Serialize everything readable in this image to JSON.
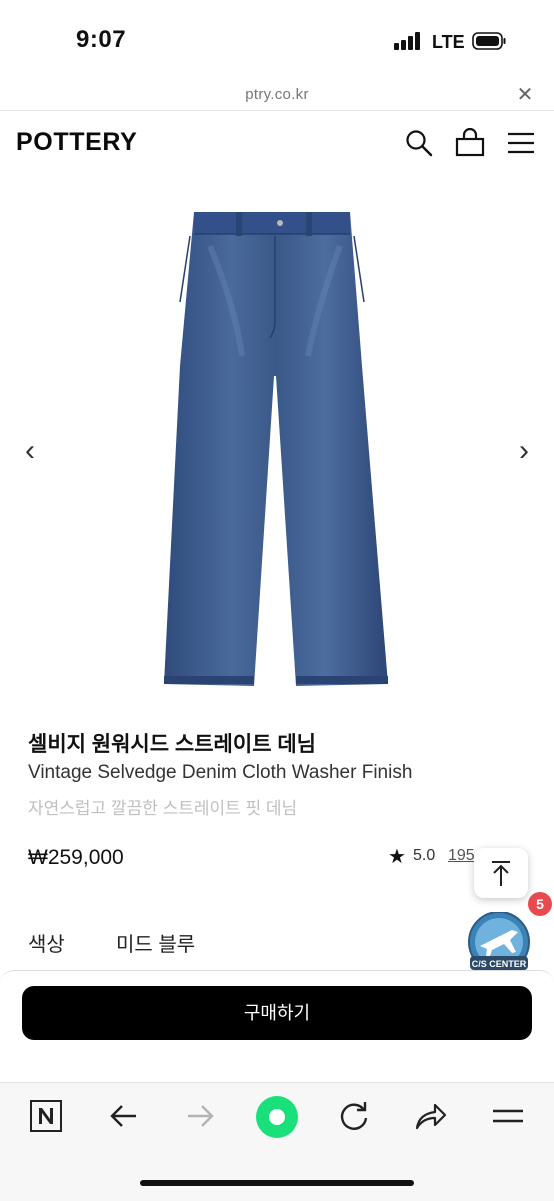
{
  "status_bar": {
    "time": "9:07",
    "network": "LTE"
  },
  "url_bar": {
    "url": "ptry.co.kr",
    "close_icon": "close-icon"
  },
  "header": {
    "logo": "POTTERY",
    "icons": [
      "search-icon",
      "shopping-bag-icon",
      "menu-icon"
    ]
  },
  "gallery": {
    "prev_arrow": "‹",
    "next_arrow": "›"
  },
  "product": {
    "name_ko": "셀비지 원워시드 스트레이트 데님",
    "name_en": "Vintage Selvedge Denim Cloth Washer Finish",
    "description": "자연스럽고 깔끔한 스트레이트 핏 데님",
    "price": "₩259,000",
    "rating": "5.0",
    "review_count": "195"
  },
  "options": {
    "color_label": "색상",
    "color_value": "미드 블루"
  },
  "floating": {
    "cs_badge": "5",
    "cs_label": "C/S CENTER"
  },
  "purchase": {
    "button_label": "구매하기"
  },
  "toolbar": {
    "icons": [
      "naver-icon",
      "back-arrow-icon",
      "forward-arrow-icon",
      "green-home-icon",
      "refresh-icon",
      "share-icon",
      "menu-icon"
    ]
  },
  "colors": {
    "denim": "#3d5a8a",
    "badge": "#e84a4f",
    "green": "#19e07a",
    "button": "#000000"
  }
}
